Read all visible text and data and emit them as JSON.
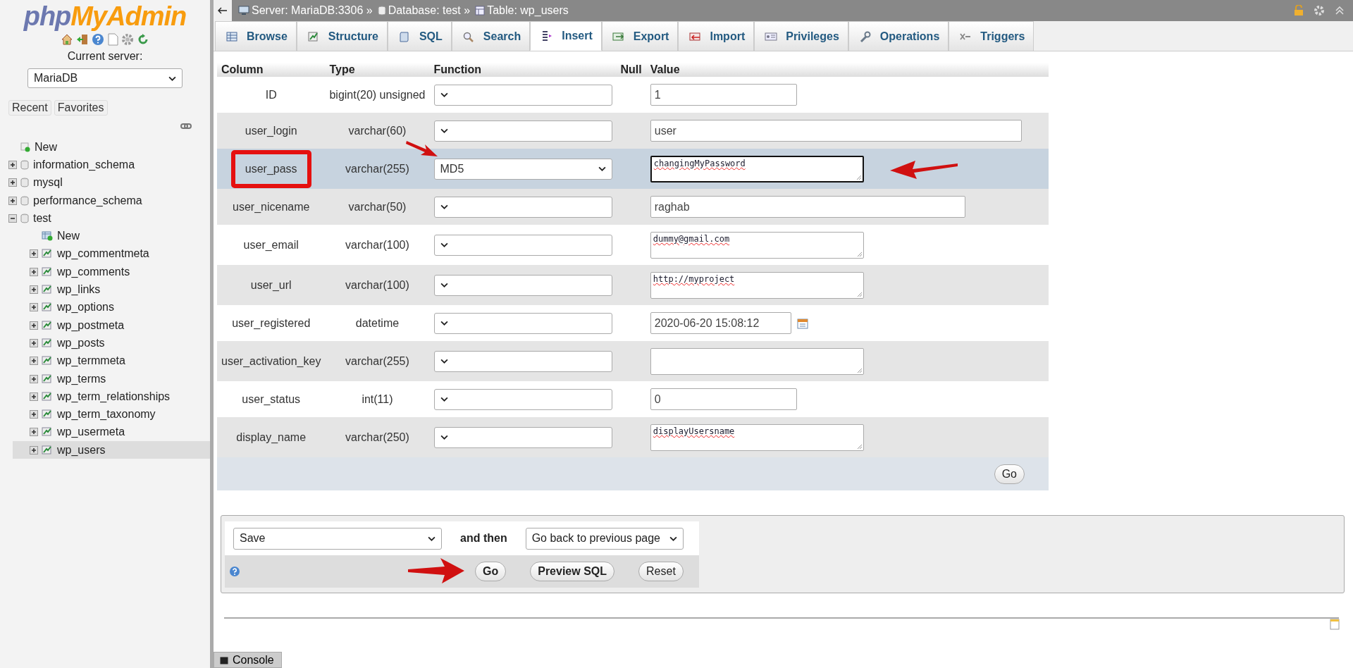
{
  "sidebar": {
    "logo": {
      "first": "php",
      "second": "MyAdmin"
    },
    "current_server_label": "Current server:",
    "server_select": "MariaDB",
    "buttons": [
      "Recent",
      "Favorites"
    ],
    "tree": [
      {
        "label": "New",
        "kind": "new",
        "selected": false
      },
      {
        "label": "information_schema",
        "kind": "db",
        "expanded": false,
        "selected": false
      },
      {
        "label": "mysql",
        "kind": "db",
        "expanded": false,
        "selected": false
      },
      {
        "label": "performance_schema",
        "kind": "db",
        "expanded": false,
        "selected": false
      },
      {
        "label": "test",
        "kind": "db",
        "expanded": true,
        "selected": false,
        "children": [
          {
            "label": "New",
            "kind": "new",
            "selected": false
          },
          {
            "label": "wp_commentmeta",
            "kind": "table",
            "selected": false
          },
          {
            "label": "wp_comments",
            "kind": "table",
            "selected": false
          },
          {
            "label": "wp_links",
            "kind": "table",
            "selected": false
          },
          {
            "label": "wp_options",
            "kind": "table",
            "selected": false
          },
          {
            "label": "wp_postmeta",
            "kind": "table",
            "selected": false
          },
          {
            "label": "wp_posts",
            "kind": "table",
            "selected": false
          },
          {
            "label": "wp_termmeta",
            "kind": "table",
            "selected": false
          },
          {
            "label": "wp_terms",
            "kind": "table",
            "selected": false
          },
          {
            "label": "wp_term_relationships",
            "kind": "table",
            "selected": false
          },
          {
            "label": "wp_term_taxonomy",
            "kind": "table",
            "selected": false
          },
          {
            "label": "wp_usermeta",
            "kind": "table",
            "selected": false
          },
          {
            "label": "wp_users",
            "kind": "table",
            "selected": true
          }
        ]
      }
    ]
  },
  "breadcrumb": [
    {
      "text": "Server: MariaDB:3306 »",
      "kind": "server"
    },
    {
      "text": "Database: test »",
      "kind": "database"
    },
    {
      "text": "Table: wp_users",
      "kind": "table"
    }
  ],
  "tabs": [
    {
      "label": "Browse",
      "selected": false
    },
    {
      "label": "Structure",
      "selected": false
    },
    {
      "label": "SQL",
      "selected": false
    },
    {
      "label": "Search",
      "selected": false
    },
    {
      "label": "Insert",
      "selected": true
    },
    {
      "label": "Export",
      "selected": false
    },
    {
      "label": "Import",
      "selected": false
    },
    {
      "label": "Privileges",
      "selected": false
    },
    {
      "label": "Operations",
      "selected": false
    },
    {
      "label": "Triggers",
      "selected": false
    }
  ],
  "table": {
    "columns": [
      "Column",
      "Type",
      "Function",
      "Null",
      "Value"
    ],
    "rows": [
      {
        "column": "ID",
        "type": "bigint(20) unsigned",
        "kind": "short",
        "value": "1",
        "highlighted": false,
        "marked": false
      },
      {
        "column": "user_login",
        "type": "varchar(60)",
        "kind": "long",
        "value": "user",
        "highlighted": false,
        "marked": false
      },
      {
        "column": "user_pass",
        "type": "varchar(255)",
        "function": "MD5",
        "kind": "textarea",
        "value": "changingMyPassword",
        "focused": true,
        "highlighted": true,
        "marked": true
      },
      {
        "column": "user_nicename",
        "type": "varchar(50)",
        "kind": "medium",
        "value": "raghab",
        "highlighted": false,
        "marked": false
      },
      {
        "column": "user_email",
        "type": "varchar(100)",
        "kind": "textarea",
        "value": "dummy@gmail.com",
        "focused": false,
        "highlighted": false,
        "marked": false
      },
      {
        "column": "user_url",
        "type": "varchar(100)",
        "kind": "textarea",
        "value": "http://myproject",
        "focused": false,
        "highlighted": false,
        "marked": false
      },
      {
        "column": "user_registered",
        "type": "datetime",
        "kind": "datetime",
        "value": "2020-06-20 15:08:12",
        "highlighted": false,
        "marked": false
      },
      {
        "column": "user_activation_key",
        "type": "varchar(255)",
        "kind": "textarea",
        "focused": false,
        "highlighted": false,
        "marked": false
      },
      {
        "column": "user_status",
        "type": "int(11)",
        "kind": "short",
        "value": "0",
        "highlighted": false,
        "marked": false
      },
      {
        "column": "display_name",
        "type": "varchar(250)",
        "kind": "textarea",
        "value": "displayUsersname",
        "focused": false,
        "highlighted": false,
        "marked": false
      }
    ],
    "go_button": "Go"
  },
  "submit": {
    "action_select": "Save",
    "and_then": "and then",
    "after_select": "Go back to previous page",
    "buttons": [
      "Go",
      "Preview SQL",
      "Reset"
    ]
  },
  "console": "Console"
}
